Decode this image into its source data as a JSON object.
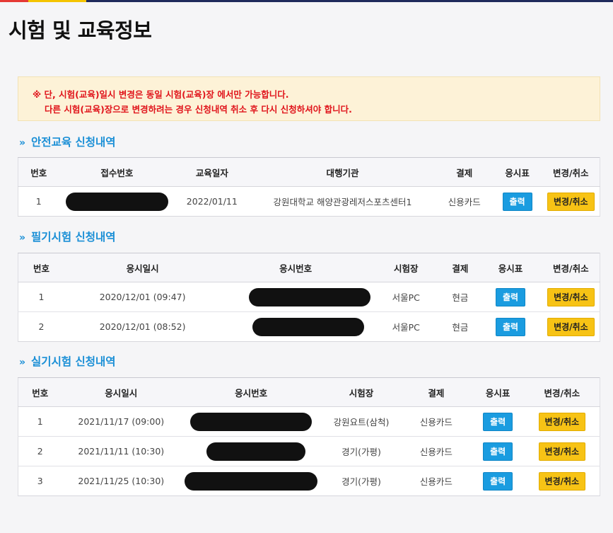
{
  "page": {
    "title": "시험 및 교육정보",
    "notice": {
      "line1": "※ 단, 시험(교육)일시 변경은 동일 시험(교육)장 에서만 가능합니다.",
      "line2": "다른 시험(교육)장으로 변경하려는 경우 신청내역 취소 후 다시 신청하셔야 합니다."
    }
  },
  "safety": {
    "title": "안전교육 신청내역",
    "headers": [
      "번호",
      "접수번호",
      "교육일자",
      "대행기관",
      "결제",
      "응시표",
      "변경/취소"
    ],
    "rows": [
      {
        "no": "1",
        "date": "2022/01/11",
        "agency": "강원대학교 해양관광레저스포츠센터1",
        "payment": "신용카드",
        "print": "출력",
        "change": "변경/취소"
      }
    ]
  },
  "written": {
    "title": "필기시험 신청내역",
    "headers": [
      "번호",
      "응시일시",
      "응시번호",
      "시험장",
      "결제",
      "응시표",
      "변경/취소"
    ],
    "rows": [
      {
        "no": "1",
        "datetime": "2020/12/01 (09:47)",
        "site": "서울PC",
        "payment": "현금",
        "print": "출력",
        "change": "변경/취소"
      },
      {
        "no": "2",
        "datetime": "2020/12/01 (08:52)",
        "site": "서울PC",
        "payment": "현금",
        "print": "출력",
        "change": "변경/취소"
      }
    ]
  },
  "practical": {
    "title": "실기시험 신청내역",
    "headers": [
      "번호",
      "응시일시",
      "응시번호",
      "시험장",
      "결제",
      "응시표",
      "변경/취소"
    ],
    "rows": [
      {
        "no": "1",
        "datetime": "2021/11/17 (09:00)",
        "site": "강원요트(삼척)",
        "payment": "신용카드",
        "print": "출력",
        "change": "변경/취소"
      },
      {
        "no": "2",
        "datetime": "2021/11/11 (10:30)",
        "site": "경기(가평)",
        "payment": "신용카드",
        "print": "출력",
        "change": "변경/취소"
      },
      {
        "no": "3",
        "datetime": "2021/11/25 (10:30)",
        "site": "경기(가평)",
        "payment": "신용카드",
        "print": "출력",
        "change": "변경/취소"
      }
    ]
  },
  "icons": {
    "section_marker": "double-chevron-right-icon"
  },
  "colors": {
    "accent": "#1a8fd6",
    "notice_text": "#e0141b",
    "print_button": "#1a9ce0",
    "change_button": "#f7c315"
  }
}
